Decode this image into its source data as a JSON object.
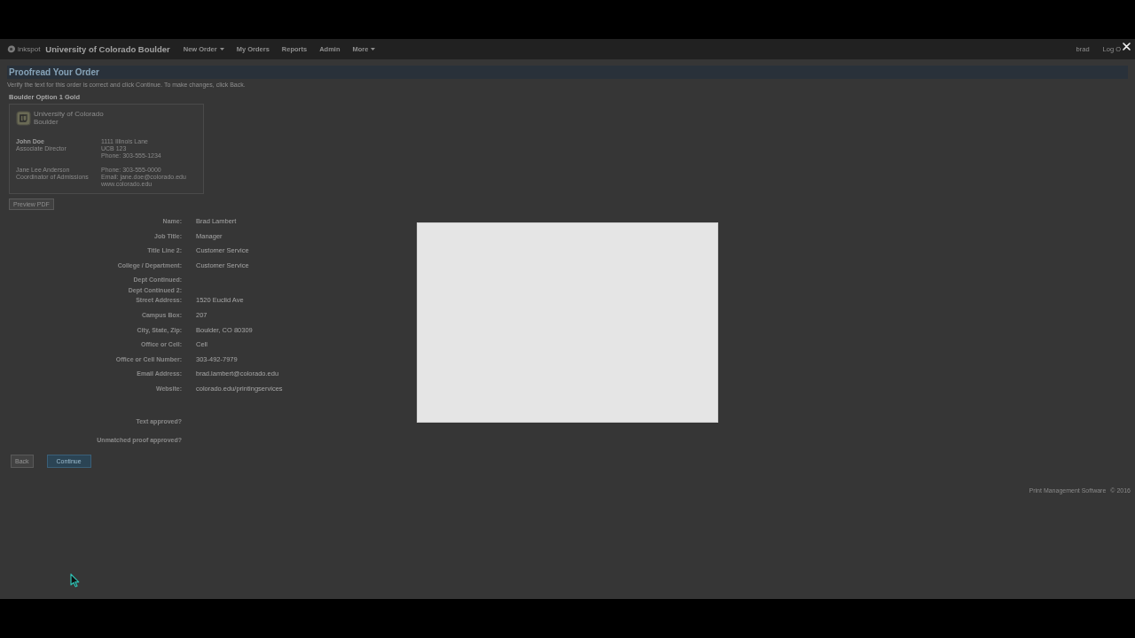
{
  "nav": {
    "logo": "inkspot",
    "brand": "University of Colorado Boulder",
    "items": [
      {
        "label": "New Order",
        "dropdown": true
      },
      {
        "label": "My Orders",
        "dropdown": false
      },
      {
        "label": "Reports",
        "dropdown": false
      },
      {
        "label": "Admin",
        "dropdown": false
      },
      {
        "label": "More",
        "dropdown": true
      }
    ],
    "user": "brad",
    "logout": "Log O"
  },
  "page": {
    "title": "Proofread Your Order",
    "instructions": "Verify the text for this order is correct and click Continue. To make changes, click Back.",
    "product": "Boulder Option 1 Gold",
    "card": {
      "logo_text": "University of Colorado Boulder",
      "blocks": [
        {
          "heading": "John Doe",
          "lines": [
            "Associate Director"
          ]
        },
        {
          "lines": [
            "1111 Illinois Lane",
            "UCB 123",
            "Phone: 303-555-1234"
          ]
        },
        {
          "lines": [
            "Jane Lee Anderson",
            "Coordinator of Admissions"
          ]
        },
        {
          "lines": [
            "Phone: 303-555-0000",
            "Email: jane.doe@colorado.edu",
            "www.colorado.edu"
          ]
        }
      ]
    },
    "preview_button": "Preview PDF",
    "fields": [
      {
        "label": "Name:",
        "value": "Brad Lambert"
      },
      {
        "label": "Job Title:",
        "value": "Manager"
      },
      {
        "label": "Title Line 2:",
        "value": "Customer Service"
      },
      {
        "label": "College / Department:",
        "value": "Customer Service"
      },
      {
        "label": "Dept Continued:"
      },
      {
        "label": "Dept Continued 2:"
      },
      {
        "label": "Street Address:",
        "value": "1520 Euclid Ave"
      },
      {
        "label": "Campus Box:",
        "value": "207"
      },
      {
        "label": "City, State, Zip:",
        "value": "Boulder, CO 80309"
      },
      {
        "label": "Office or Cell:",
        "value": "Cell"
      },
      {
        "label": "Office or Cell Number:",
        "value": "303-492-7979"
      },
      {
        "label": "Email Address:",
        "value": "brad.lambert@colorado.edu"
      },
      {
        "label": "Website:",
        "value": "colorado.edu/printingservices"
      }
    ],
    "approvals": [
      {
        "label": "Text approved?"
      },
      {
        "label": "Unmatched proof approved?"
      }
    ],
    "buttons": [
      {
        "label": "Back",
        "kind": "secondary"
      },
      {
        "label": "Continue",
        "kind": "primary"
      }
    ]
  },
  "footer": {
    "text": "Print Management Software",
    "version": "© 2016"
  },
  "modal": {
    "open": true
  }
}
